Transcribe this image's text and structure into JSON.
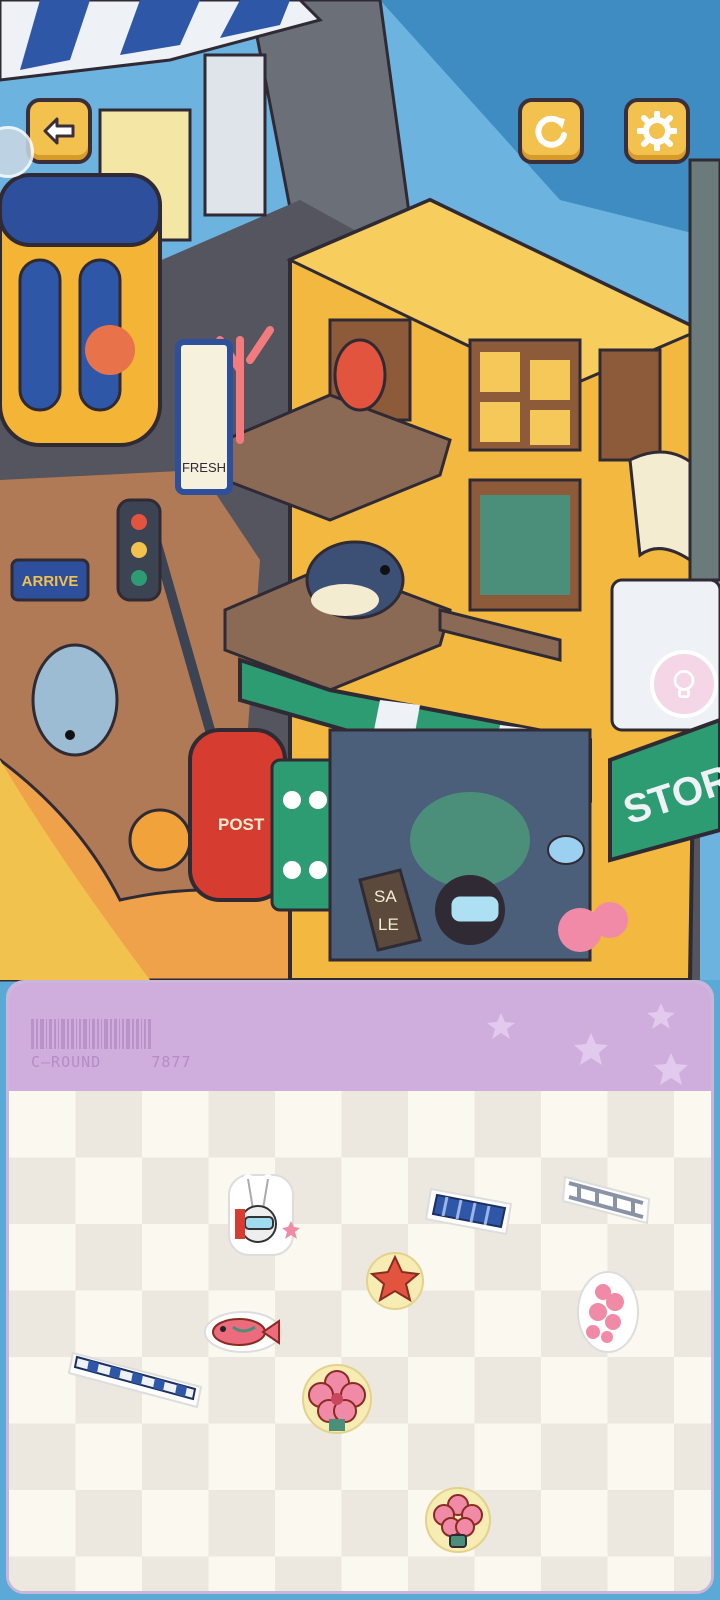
{
  "hud": {
    "back_icon": "arrow-left-icon",
    "restart_icon": "restart-icon",
    "settings_icon": "gear-icon",
    "hint_icon": "lightbulb-icon"
  },
  "scene": {
    "signs": {
      "fresh": "FRESH",
      "arrive": "ARRIVE",
      "post": "POST",
      "sale_line1": "SA",
      "sale_line2": "LE",
      "store": "STOR"
    }
  },
  "panel": {
    "round_label": "C—ROUND     7877",
    "items": [
      "bunny-diver-sticker",
      "blue-bench-sticker",
      "metal-railing-sticker",
      "red-starfish-sticker",
      "pink-coral-sticker",
      "pink-fish-sticker",
      "striped-awning-sticker",
      "pink-flower-sticker",
      "pink-flower-pot-sticker"
    ]
  },
  "colors": {
    "button": "#f2c14e",
    "panel_header": "#cfaddd",
    "sky": "#5aa9d6",
    "building": "#f2b840",
    "awning": "#2d9c73"
  }
}
